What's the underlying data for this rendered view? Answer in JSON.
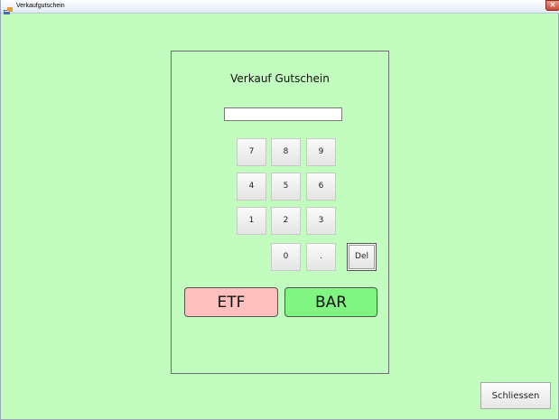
{
  "window": {
    "title": "Verkaufgutschein",
    "close_glyph": "✕",
    "icon": "app-icon"
  },
  "panel": {
    "title": "Verkauf Gutschein",
    "amount_value": ""
  },
  "keypad": {
    "keys": [
      "7",
      "8",
      "9",
      "4",
      "5",
      "6",
      "1",
      "2",
      "3",
      "0",
      ".",
      "Del"
    ]
  },
  "payment": {
    "etf_label": "ETF",
    "bar_label": "BAR"
  },
  "footer": {
    "close_label": "Schliessen"
  },
  "colors": {
    "background": "#c2fcbf",
    "etf": "#ffbfbf",
    "bar": "#80f582"
  }
}
